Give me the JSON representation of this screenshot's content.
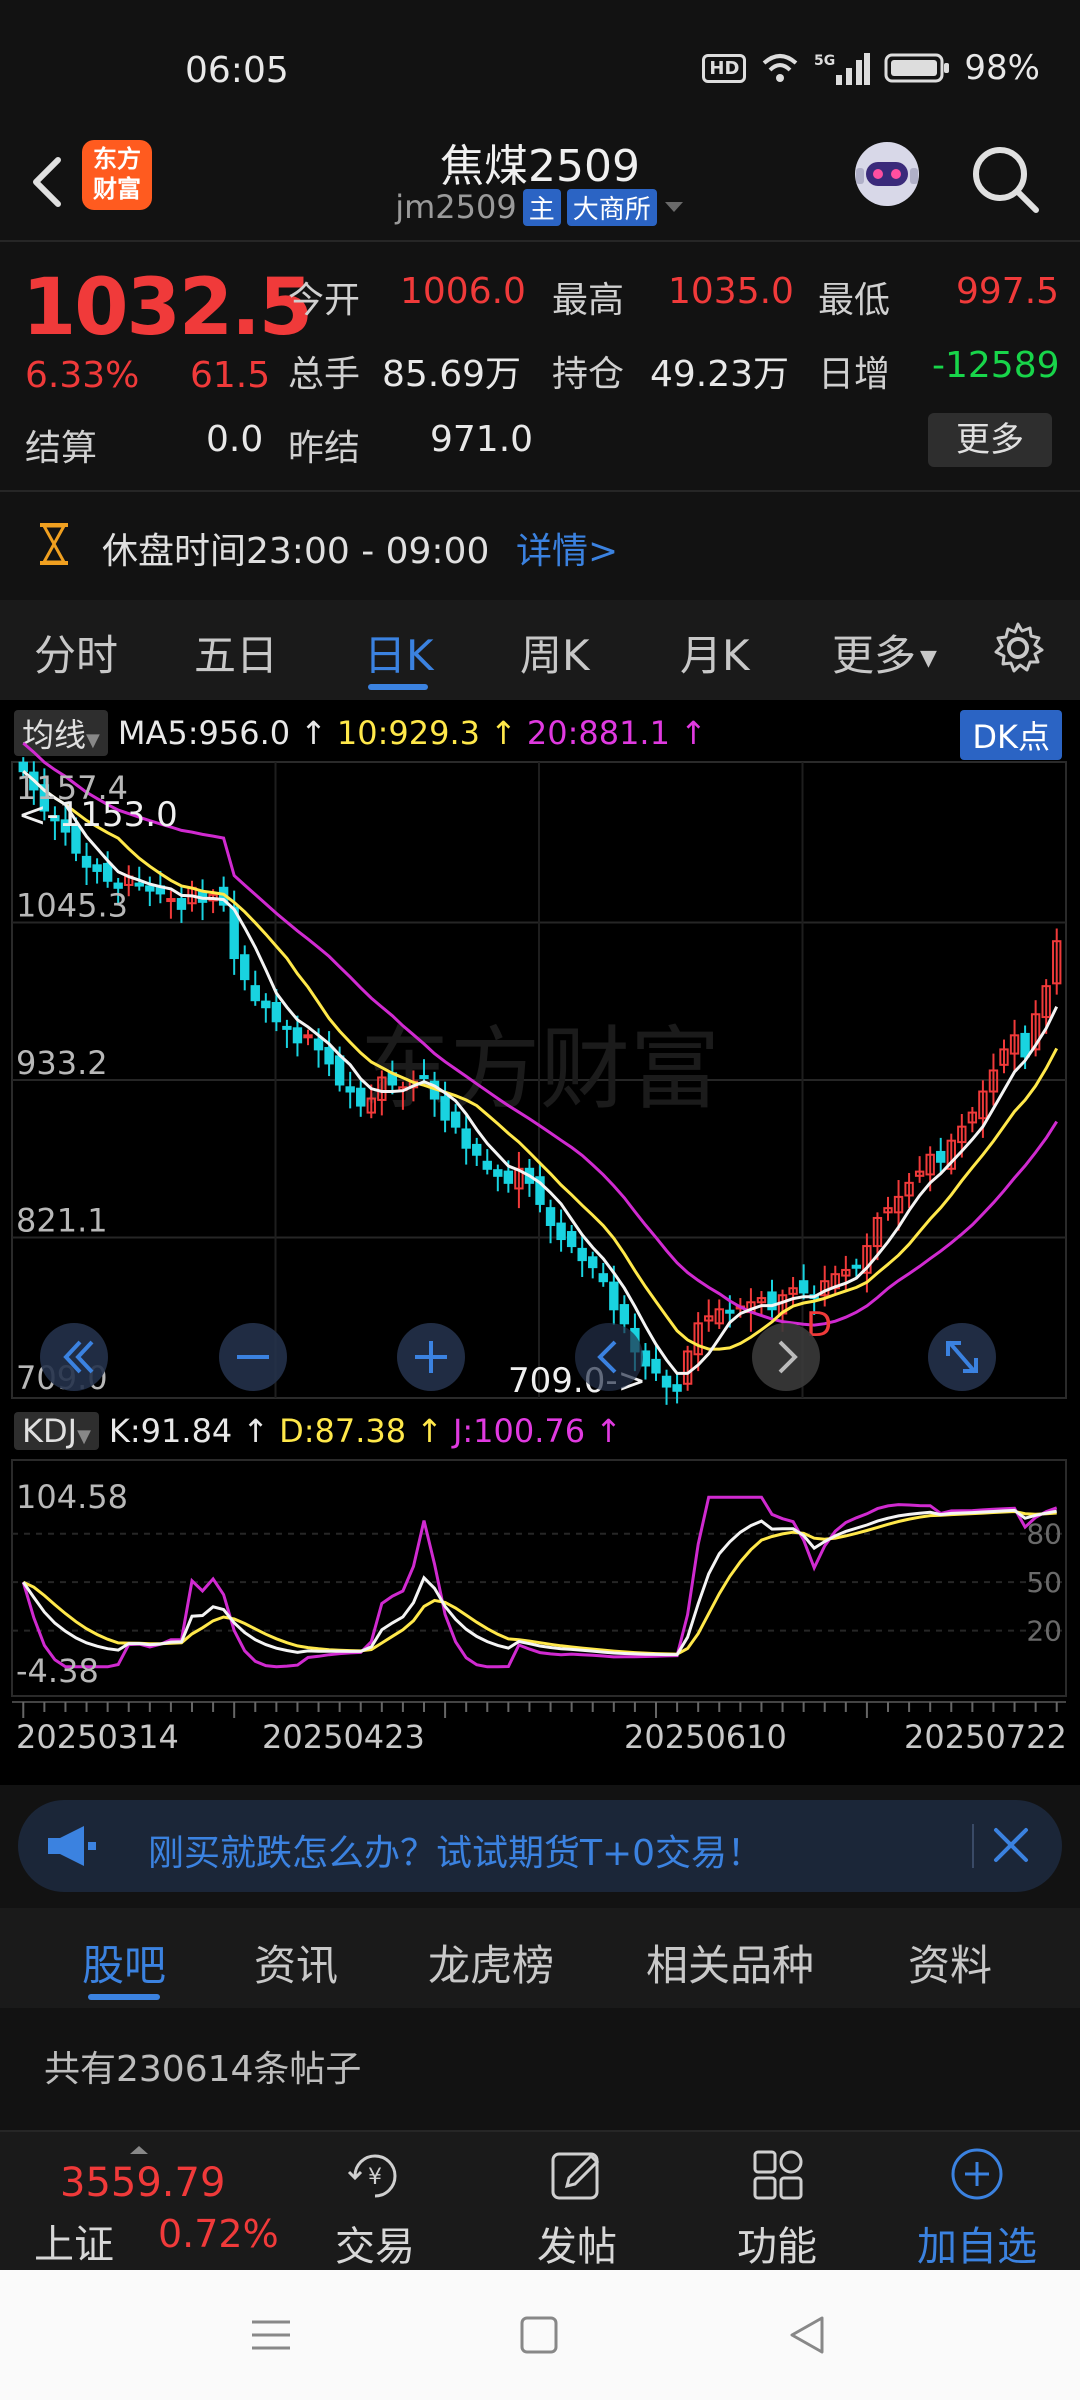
{
  "status": {
    "time": "06:05",
    "hd": "HD",
    "network": "5G",
    "battery": "98%"
  },
  "header": {
    "logo_line1": "东方",
    "logo_line2": "财富",
    "title": "焦煤2509",
    "code": "jm2509",
    "tag_main": "主",
    "exchange": "大商所"
  },
  "quote": {
    "price": "1032.5",
    "change_pct": "6.33%",
    "change": "61.5",
    "open_label": "今开",
    "open": "1006.0",
    "high_label": "最高",
    "high": "1035.0",
    "low_label": "最低",
    "low": "997.5",
    "volume_label": "总手",
    "volume": "85.69万",
    "oi_label": "持仓",
    "oi": "49.23万",
    "daily_inc_label": "日增",
    "daily_inc": "-12589",
    "settle_label": "结算",
    "settle": "0.0",
    "prev_settle_label": "昨结",
    "prev_settle": "971.0",
    "more": "更多"
  },
  "session": {
    "text": "休盘时间23:00 - 09:00",
    "link": "详情>"
  },
  "period_tabs": [
    "分时",
    "五日",
    "日K",
    "周K",
    "月K",
    "更多"
  ],
  "ma_bar": {
    "button": "均线",
    "ma5": "MA5:956.0",
    "ma10": "10:929.3",
    "ma20": "20:881.1",
    "dk": "DK点"
  },
  "kdj_bar": {
    "button": "KDJ",
    "k": "K:91.84",
    "d": "D:87.38",
    "j": "J:100.76"
  },
  "chart_data": {
    "type": "candlestick",
    "price_axis_labels": [
      "1157.4",
      "1045.3",
      "933.2",
      "821.1",
      "709.0"
    ],
    "ylim": [
      709.0,
      1157.4
    ],
    "max_marker": "<-1153.0",
    "min_marker": "709.0->",
    "dk_marker": "D",
    "kdj_axis_labels": [
      "104.58",
      "-4.38"
    ],
    "kdj_ref_levels": [
      "80",
      "50",
      "20"
    ],
    "date_labels": [
      "20250314",
      "20250423",
      "20250610",
      "20250722"
    ],
    "closes": [
      1153,
      1140,
      1125,
      1118,
      1110,
      1095,
      1085,
      1082,
      1075,
      1070,
      1078,
      1072,
      1068,
      1066,
      1062,
      1055,
      1070,
      1060,
      1065,
      1058,
      1020,
      1005,
      990,
      985,
      975,
      970,
      960,
      965,
      955,
      945,
      930,
      925,
      915,
      920,
      935,
      930,
      928,
      932,
      935,
      920,
      905,
      900,
      885,
      880,
      870,
      865,
      860,
      870,
      860,
      845,
      830,
      820,
      815,
      805,
      800,
      790,
      770,
      760,
      740,
      730,
      725,
      715,
      712,
      740,
      760,
      765,
      770,
      768,
      772,
      775,
      778,
      770,
      780,
      785,
      782,
      778,
      790,
      795,
      798,
      800,
      815,
      835,
      842,
      850,
      860,
      868,
      880,
      875,
      890,
      900,
      910,
      925,
      940,
      955,
      965,
      950,
      980,
      1000,
      1032
    ],
    "ma5_last": 956.0,
    "ma10_last": 929.3,
    "ma20_last": 881.1,
    "k_last": 91.84,
    "d_last": 87.38,
    "j_last": 100.76
  },
  "banner": {
    "text": "刚买就跌怎么办？试试期货T+0交易！"
  },
  "content_tabs": [
    "股吧",
    "资讯",
    "龙虎榜",
    "相关品种",
    "资料"
  ],
  "posts": "共有230614条帖子",
  "index": {
    "value": "3559.79",
    "name": "上证",
    "pct": "0.72%"
  },
  "bottom_nav": [
    "交易",
    "发帖",
    "功能",
    "加自选"
  ]
}
